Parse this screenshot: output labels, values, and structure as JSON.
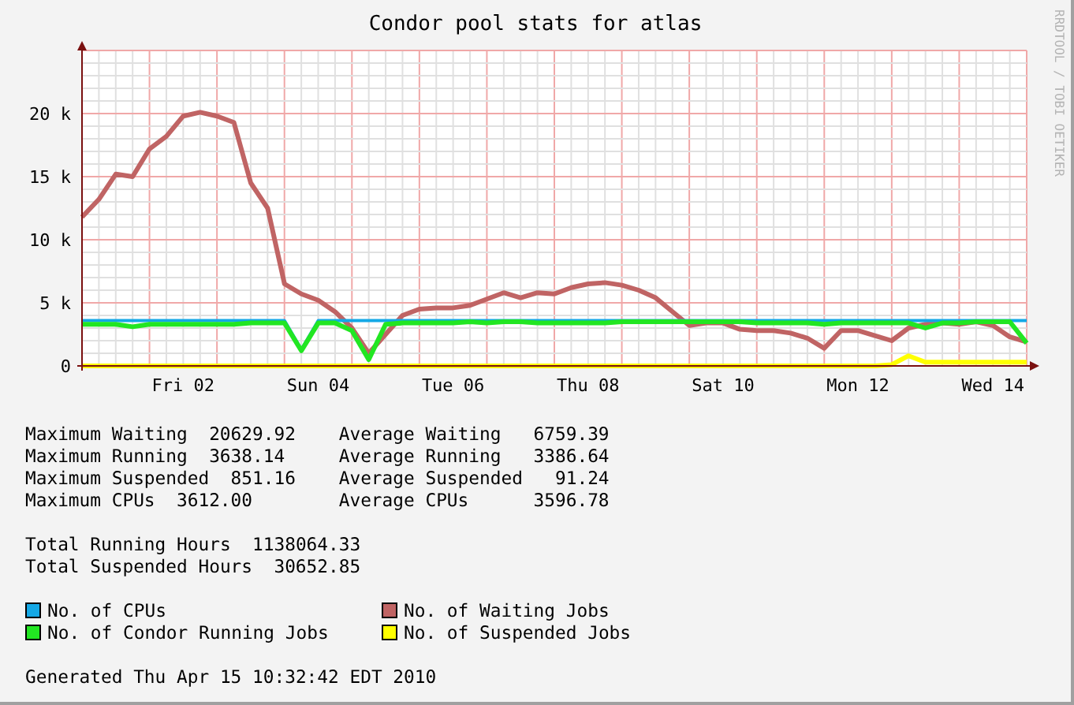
{
  "title": "Condor pool stats for atlas",
  "watermark_text": "RRDTOOL / TOBI OETIKER",
  "chart_data": {
    "type": "line",
    "grid": true,
    "ylim": [
      0,
      25000
    ],
    "categories": [
      null,
      null,
      null,
      null,
      null,
      null,
      "Fri 02",
      null,
      null,
      null,
      null,
      null,
      null,
      null,
      "Sun 04",
      null,
      null,
      null,
      null,
      null,
      null,
      null,
      "Tue 06",
      null,
      null,
      null,
      null,
      null,
      null,
      null,
      "Thu 08",
      null,
      null,
      null,
      null,
      null,
      null,
      null,
      "Sat 10",
      null,
      null,
      null,
      null,
      null,
      null,
      null,
      "Mon 12",
      null,
      null,
      null,
      null,
      null,
      null,
      null,
      "Wed 14",
      null,
      null
    ],
    "yticks": [
      {
        "value": 0,
        "label": "0"
      },
      {
        "value": 5000,
        "label": "5 k"
      },
      {
        "value": 10000,
        "label": "10 k"
      },
      {
        "value": 15000,
        "label": "15 k"
      },
      {
        "value": 20000,
        "label": "20 k"
      }
    ],
    "series": [
      {
        "name": "No. of Waiting Jobs",
        "color": "#c06464",
        "values": [
          11800,
          13200,
          15200,
          15000,
          17200,
          18200,
          19800,
          20100,
          19800,
          19300,
          14500,
          12500,
          6500,
          5700,
          5200,
          4300,
          3000,
          1000,
          2500,
          4000,
          4500,
          4600,
          4600,
          4800,
          5300,
          5800,
          5400,
          5800,
          5700,
          6200,
          6500,
          6600,
          6400,
          6000,
          5400,
          4300,
          3200,
          3400,
          3400,
          2900,
          2800,
          2800,
          2600,
          2200,
          1400,
          2800,
          2800,
          2400,
          2000,
          3000,
          3300,
          3400,
          3300,
          3500,
          3200,
          2300,
          1900
        ]
      },
      {
        "name": "No. of CPUs",
        "color": "#14a8e6",
        "values": [
          3600,
          3600,
          3600,
          3600,
          3600,
          3600,
          3600,
          3600,
          3600,
          3600,
          3600,
          3600,
          3600,
          1300,
          3600,
          3600,
          3600,
          3600,
          3600,
          3600,
          3600,
          3600,
          3600,
          3600,
          3600,
          3600,
          3600,
          3600,
          3600,
          3600,
          3600,
          3600,
          3600,
          3600,
          3600,
          3600,
          3600,
          3600,
          3600,
          3600,
          3600,
          3600,
          3600,
          3600,
          3600,
          3600,
          3600,
          3600,
          3600,
          3600,
          3600,
          3600,
          3600,
          3600,
          3600,
          3600,
          3600
        ]
      },
      {
        "name": "No. of Condor Running Jobs",
        "color": "#22e622",
        "values": [
          3300,
          3300,
          3300,
          3100,
          3300,
          3300,
          3300,
          3300,
          3300,
          3300,
          3400,
          3400,
          3400,
          1200,
          3400,
          3400,
          2800,
          500,
          3300,
          3400,
          3400,
          3400,
          3400,
          3500,
          3400,
          3500,
          3500,
          3400,
          3400,
          3400,
          3400,
          3400,
          3500,
          3500,
          3500,
          3500,
          3500,
          3500,
          3500,
          3500,
          3400,
          3400,
          3400,
          3400,
          3300,
          3400,
          3400,
          3400,
          3400,
          3400,
          3000,
          3400,
          3400,
          3500,
          3500,
          3500,
          1800
        ]
      },
      {
        "name": "No. of Suspended Jobs",
        "color": "#ffff00",
        "values": [
          0,
          0,
          0,
          0,
          0,
          0,
          0,
          0,
          0,
          0,
          0,
          0,
          0,
          0,
          0,
          0,
          0,
          0,
          0,
          0,
          0,
          0,
          0,
          0,
          0,
          0,
          0,
          0,
          0,
          0,
          0,
          0,
          0,
          0,
          0,
          0,
          0,
          0,
          0,
          0,
          0,
          0,
          0,
          0,
          0,
          0,
          0,
          0,
          100,
          800,
          300,
          300,
          300,
          300,
          300,
          300,
          300
        ]
      }
    ]
  },
  "stats": [
    {
      "left_label": "Maximum Waiting",
      "left_value": "20629.92",
      "right_label": "Average Waiting",
      "right_value": "6759.39"
    },
    {
      "left_label": "Maximum Running",
      "left_value": "3638.14",
      "right_label": "Average Running",
      "right_value": "3386.64"
    },
    {
      "left_label": "Maximum Suspended",
      "left_value": "851.16",
      "right_label": "Average Suspended",
      "right_value": "91.24"
    },
    {
      "left_label": "Maximum CPUs",
      "left_value": "3612.00",
      "right_label": "Average CPUs",
      "right_value": "3596.78"
    }
  ],
  "totals": [
    {
      "label": "Total Running Hours",
      "value": "1138064.33"
    },
    {
      "label": "Total Suspended Hours",
      "value": "30652.85"
    }
  ],
  "generated": "Generated Thu Apr 15 10:32:42 EDT 2010"
}
